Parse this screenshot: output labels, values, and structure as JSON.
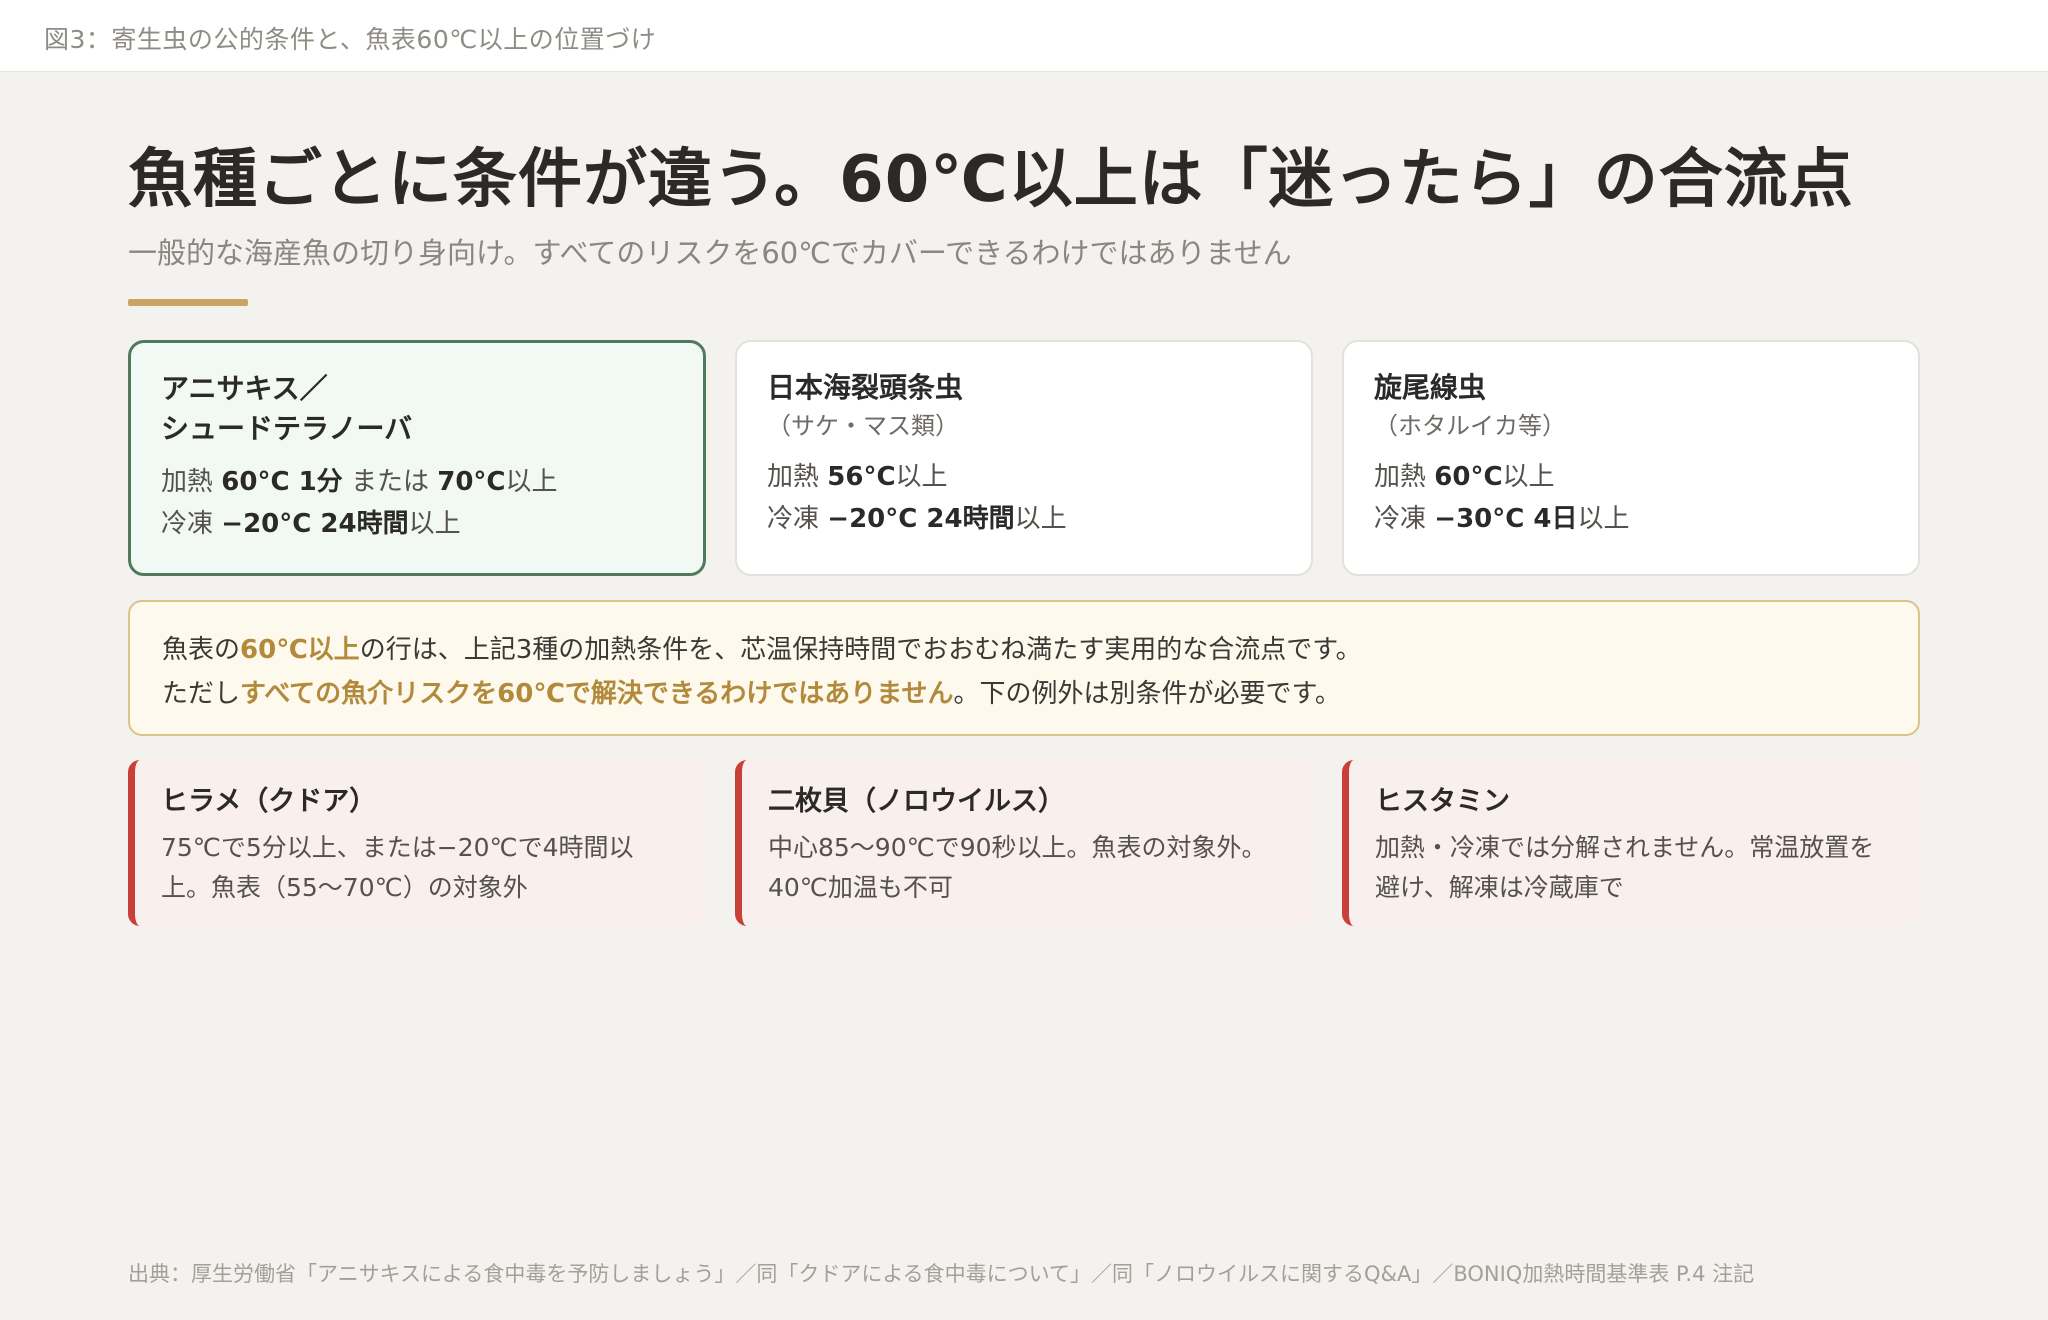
{
  "caption": "図3：寄生虫の公的条件と、魚表60℃以上の位置づけ",
  "title": "魚種ごとに条件が違う。60℃以上は「迷ったら」の合流点",
  "subtitle": "一般的な海産魚の切り身向け。すべてのリスクを60℃でカバーできるわけではありません",
  "colors": {
    "accent": "#c9a465",
    "highlight_border": "#4e7a5d",
    "highlight_bg": "#f2f8f4",
    "note_bg": "#fdf9ec",
    "note_border": "#dcc389",
    "note_text_accent": "#b38a3c",
    "warning_border": "#c9403a",
    "warning_bg": "#f9efec"
  },
  "cards": [
    {
      "title_line1": "アニサキス／",
      "title_line2": "シュードテラノーバ",
      "heat_label": "加熱",
      "heat_val1": "60°C 1分",
      "heat_or": "または",
      "heat_val2": "70°C",
      "heat_suffix": "以上",
      "freeze_label": "冷凍",
      "freeze_val": "−20°C 24時間",
      "freeze_suffix": "以上"
    },
    {
      "title": "日本海裂頭条虫",
      "sub": "（サケ・マス類）",
      "heat_label": "加熱",
      "heat_val": "56°C",
      "heat_suffix": "以上",
      "freeze_label": "冷凍",
      "freeze_val": "−20°C 24時間",
      "freeze_suffix": "以上"
    },
    {
      "title": "旋尾線虫",
      "sub": "（ホタルイカ等）",
      "heat_label": "加熱",
      "heat_val": "60°C",
      "heat_suffix": "以上",
      "freeze_label": "冷凍",
      "freeze_val": "−30°C 4日",
      "freeze_suffix": "以上"
    }
  ],
  "note": {
    "l1_a": "魚表の",
    "l1_hl": "60℃以上",
    "l1_b": "の行は、上記3種の加熱条件を、芯温保持時間でおおむね満たす実用的な合流点です。",
    "l2_a": "ただし",
    "l2_hl": "すべての魚介リスクを60℃で解決できるわけではありません",
    "l2_b": "。下の例外は別条件が必要です。"
  },
  "exceptions": [
    {
      "title": "ヒラメ（クドア）",
      "line1": "75℃で5分以上、または−20℃で4時間以",
      "line2": "上。魚表（55〜70℃）の対象外"
    },
    {
      "title": "二枚貝（ノロウイルス）",
      "line1": "中心85〜90℃で90秒以上。魚表の対象外。",
      "line2": "40℃加温も不可"
    },
    {
      "title": "ヒスタミン",
      "line1": "加熱・冷凍では分解されません。常温放置を",
      "line2": "避け、解凍は冷蔵庫で"
    }
  ],
  "source": "出典：厚生労働省「アニサキスによる食中毒を予防しましょう」／同「クドアによる食中毒について」／同「ノロウイルスに関するQ&A」／BONIQ加熱時間基準表 P.4 注記"
}
